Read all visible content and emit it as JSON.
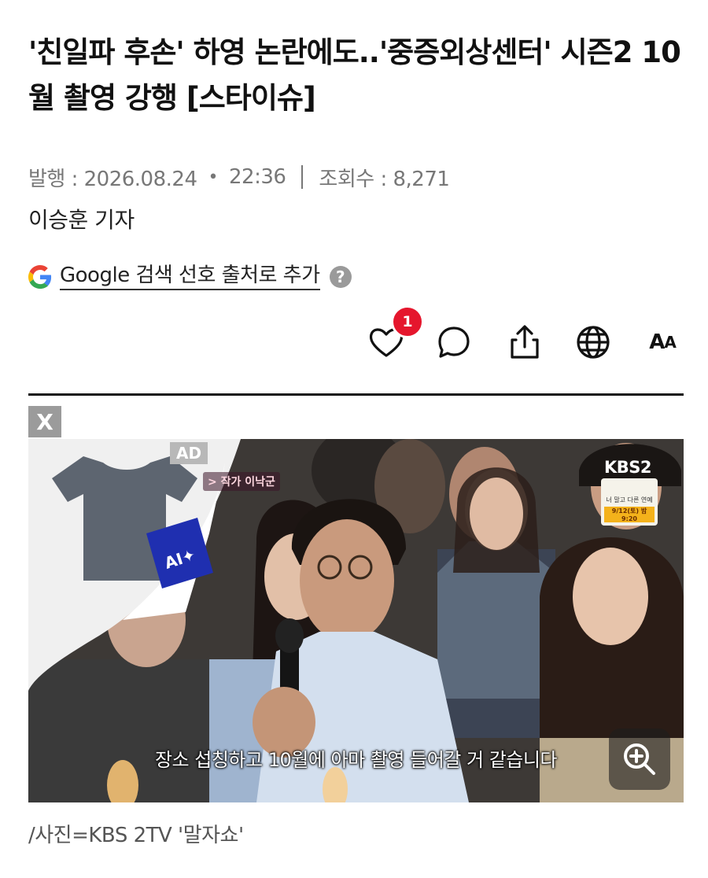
{
  "article": {
    "headline": "'친일파 후손' 하영 논란에도..'중증외상센터' 시즌2 10월 촬영 강행 [스타이슈]",
    "published_label": "발행 : 2026.08.24",
    "published_time": "22:36",
    "views_label": "조회수 : 8,271",
    "reporter": "이승훈 기자"
  },
  "google_pref": {
    "text": "Google 검색 선호 출처로 추가",
    "help": "?"
  },
  "actions": {
    "like_count": "1",
    "font_label_big": "A",
    "font_label_small": "A"
  },
  "ad": {
    "close_label": "X",
    "ad_label": "AD",
    "brand_text": "AI✦"
  },
  "photo": {
    "author_tag": "> 작가 이낙군",
    "broadcaster_logo": "KBS2",
    "show_card_title": "너 말고 다른 연예",
    "show_card_date": "9/12(토) 밤 9:20",
    "subtitle": "장소 섭칭하고 10월에 아마 촬영 들어갈 거 같습니다"
  },
  "caption": "/사진=KBS 2TV '말자쇼'",
  "colors": {
    "badge": "#e5162d",
    "ad_brand_blue": "#1f2fb0",
    "text_primary": "#111111",
    "text_meta": "#777777"
  }
}
